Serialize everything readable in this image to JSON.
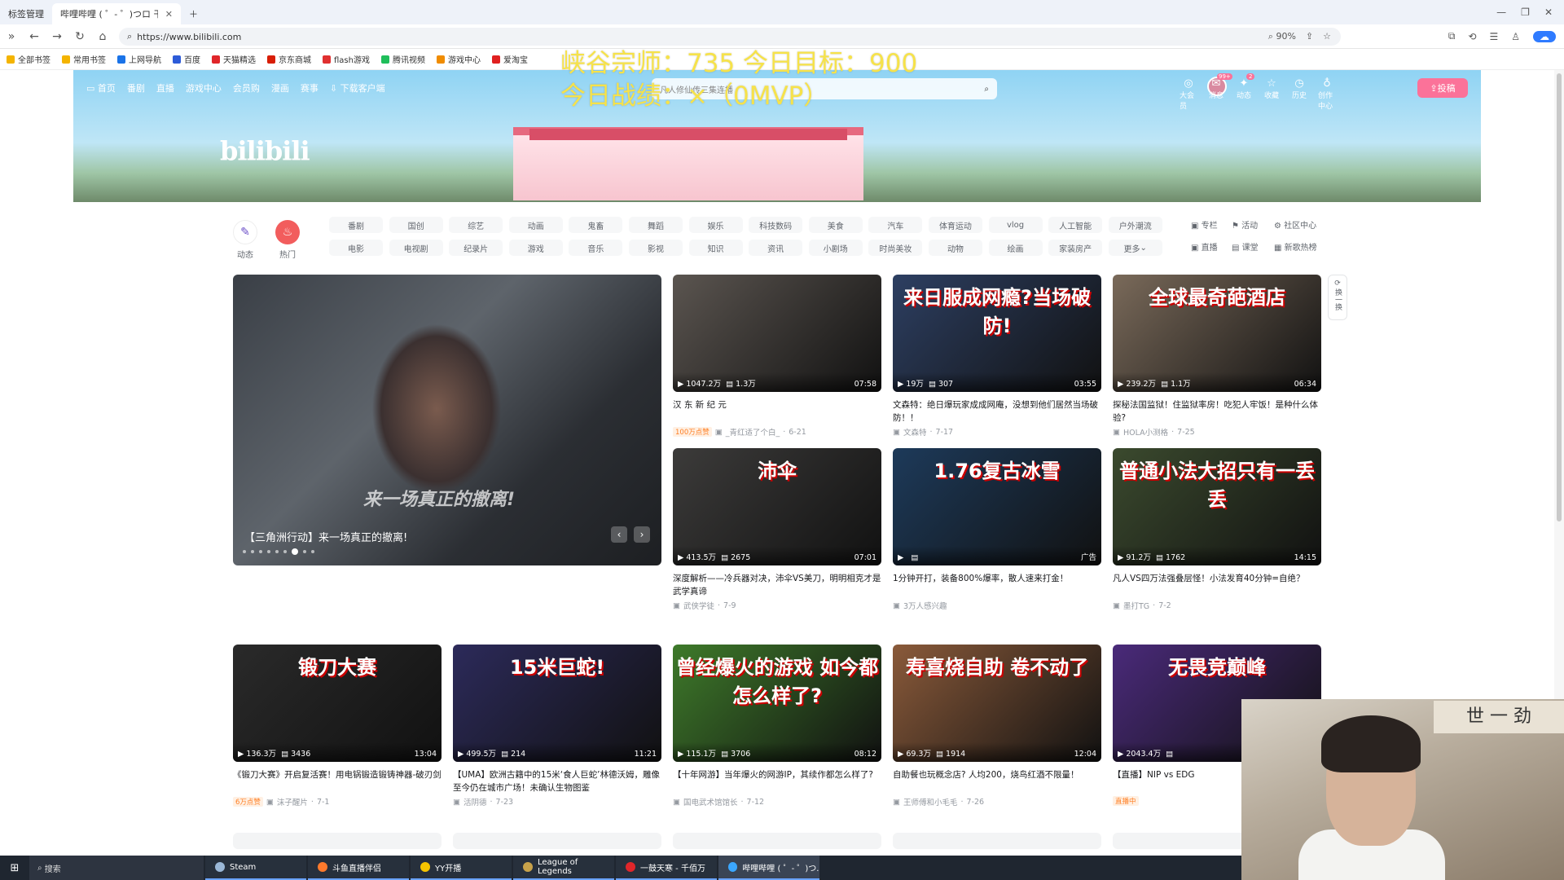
{
  "browser": {
    "tabs": [
      {
        "label": "标签管理"
      },
      {
        "label": "哔哩哔哩 ( ゜- ゜)つロ 干杯~-b"
      }
    ],
    "url": "https://www.bilibili.com",
    "zoom": "90%",
    "bookmarks": [
      "全部书签",
      "常用书签",
      "上网导航",
      "百度",
      "天猫精选",
      "京东商城",
      "flash游戏",
      "腾讯视频",
      "游戏中心",
      "爱淘宝"
    ]
  },
  "header": {
    "nav": [
      "首页",
      "番剧",
      "直播",
      "游戏中心",
      "会员购",
      "漫画",
      "赛事",
      "下载客户端"
    ],
    "search_placeholder": "凡人修仙传三集连播",
    "right_nav": [
      "大会员",
      "消息",
      "动态",
      "收藏",
      "历史",
      "创作中心"
    ],
    "message_badge": "99+",
    "dynamic_badge": "2",
    "upload_label": "投稿",
    "logo": "bilibili"
  },
  "overlay": {
    "line1": "峡谷宗师：735 今日目标：900",
    "line2": "今日战绩：×（0MVP）"
  },
  "channels": {
    "dynamic_label": "动态",
    "hot_label": "热门",
    "categories": [
      "番剧",
      "国创",
      "综艺",
      "动画",
      "鬼畜",
      "舞蹈",
      "娱乐",
      "科技数码",
      "美食",
      "汽车",
      "体育运动",
      "vlog",
      "人工智能",
      "户外潮流",
      "电影",
      "电视剧",
      "纪录片",
      "游戏",
      "音乐",
      "影视",
      "知识",
      "资讯",
      "小剧场",
      "时尚美妆",
      "动物",
      "绘画",
      "家装房产",
      "更多"
    ],
    "right": [
      "专栏",
      "活动",
      "社区中心",
      "直播",
      "课堂",
      "新歌热榜"
    ]
  },
  "carousel": {
    "caption": "【三角洲行动】来一场真正的撤离!",
    "watermark": "来一场真正的撤离!",
    "dots": 9,
    "active_dot": 6
  },
  "side_control": {
    "label": "换一换"
  },
  "cards": [
    {
      "title": "汉 东 新 纪 元",
      "views": "1047.2万",
      "danmaku": "1.3万",
      "duration": "07:58",
      "badge": "100万点赞",
      "author": "_青红适了个白_",
      "date": "6-21",
      "thumb_text": "",
      "thumb_color": "#5b5550"
    },
    {
      "title": "文森特：绝日爆玩家成成网庵，没想到他们居然当场破防！！",
      "views": "19万",
      "danmaku": "307",
      "duration": "03:55",
      "badge": "",
      "author": "文森特",
      "date": "7-17",
      "thumb_text": "来日服成网瘾?当场破防!",
      "thumb_color": "#2d3f62"
    },
    {
      "title": "探秘法国监狱！住监狱率房！吃犯人牢饭！是种什么体验?",
      "views": "239.2万",
      "danmaku": "1.1万",
      "duration": "06:34",
      "badge": "",
      "author": "HOLA小测格",
      "date": "7-25",
      "thumb_text": "全球最奇葩酒店",
      "thumb_color": "#7a6a5a"
    },
    {
      "title": "深度解析——冷兵器对决，沛伞VS美刀，明明相克才是武学真谛",
      "views": "413.5万",
      "danmaku": "2675",
      "duration": "07:01",
      "badge": "",
      "author": "武侠学徒",
      "date": "7-9",
      "thumb_text": "沛伞",
      "thumb_color": "#3c3b3a"
    },
    {
      "title": "1分钟开打，装备800%爆率，散人速来打金！",
      "views": "",
      "danmaku": "",
      "duration": "广告",
      "badge": "",
      "author": "3万人感兴趣",
      "date": "",
      "thumb_text": "1.76复古冰雪",
      "thumb_color": "#1d3a5a"
    },
    {
      "title": "凡人VS四万法强叠层怪！小法发育40分钟=自绝？",
      "views": "91.2万",
      "danmaku": "1762",
      "duration": "14:15",
      "badge": "",
      "author": "墨打TG",
      "date": "7-2",
      "thumb_text": "普通小法大招只有一丢丢",
      "thumb_color": "#3b4a2e"
    },
    {
      "title": "《锻刀大赛》开启复活赛！用电锅锻造锻铸神器-破刃剑",
      "views": "136.3万",
      "danmaku": "3436",
      "duration": "13:04",
      "badge": "6万点赞",
      "author": "沫子醒片",
      "date": "7-1",
      "thumb_text": "锻刀大赛",
      "thumb_color": "#2a2a2a"
    },
    {
      "title": "【UMA】欧洲古籍中的15米‘食人巨蛇’林德沃姆，雕像至今仍在城市广场！未确认生物图鉴",
      "views": "499.5万",
      "danmaku": "214",
      "duration": "11:21",
      "badge": "",
      "author": "活阴德",
      "date": "7-23",
      "thumb_text": "15米巨蛇!",
      "thumb_color": "#2c2a5a"
    },
    {
      "title": "【十年网游】当年爆火的网游IP，其续作都怎么样了?",
      "views": "115.1万",
      "danmaku": "3706",
      "duration": "08:12",
      "badge": "",
      "author": "国电武术馆馆长",
      "date": "7-12",
      "thumb_text": "曾经爆火的游戏 如今都怎么样了?",
      "thumb_color": "#3e7a2a"
    },
    {
      "title": "自助餐也玩概念店? 人均200，烧鸟红酒不限量！",
      "views": "69.3万",
      "danmaku": "1914",
      "duration": "12:04",
      "badge": "",
      "author": "王师傅和小毛毛",
      "date": "7-26",
      "thumb_text": "寿喜烧自助 卷不动了",
      "thumb_color": "#8a5a3a"
    },
    {
      "title": "【直播】NIP vs EDG",
      "views": "2043.4万",
      "danmaku": "",
      "duration": "",
      "badge": "直播中",
      "author": "",
      "date": "",
      "thumb_text": "无畏竞巅峰",
      "thumb_color": "#4a2a7a"
    }
  ],
  "webcam": {
    "calendar_text": "世 一 劲"
  },
  "taskbar": {
    "search_label": "搜索",
    "items": [
      "Steam",
      "斗鱼直播伴侣",
      "YY开播",
      "League of Legends",
      "一鼓天寒 - 千佰万",
      "哔哩哔哩 ( ゜- ゜)つ..."
    ]
  }
}
